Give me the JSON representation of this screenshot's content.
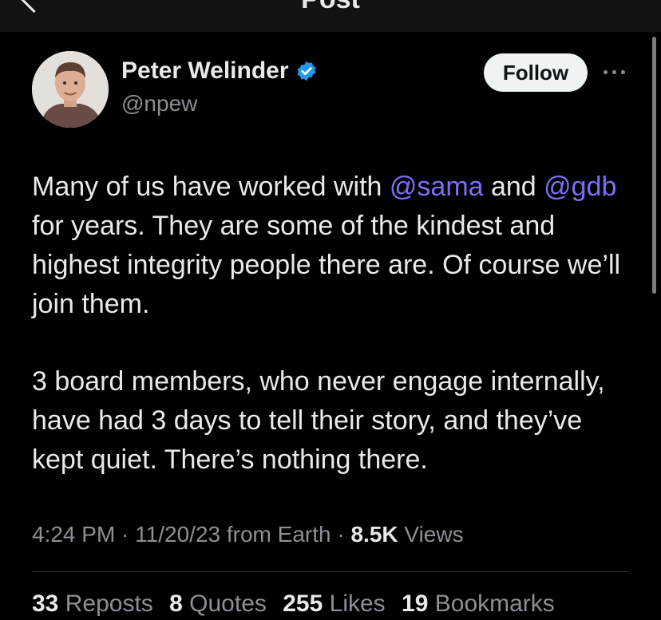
{
  "header": {
    "title": "Post"
  },
  "author": {
    "name": "Peter Welinder",
    "handle": "@npew",
    "verified": true,
    "verified_color": "#1d9bf0"
  },
  "follow_label": "Follow",
  "tweet": {
    "paragraph1": {
      "part1": "Many of us have worked with ",
      "mention1": "@sama",
      "part2": " and ",
      "mention2": "@gdb",
      "part3": " for years. They are some of the kindest and highest integrity people there are. Of course we’ll join them."
    },
    "paragraph2": "3 board members, who never engage internally, have had 3 days to tell their story, and they’ve kept quiet. There’s nothing there.",
    "mention_color": "#7c6ff6"
  },
  "meta": {
    "time": "4:24 PM",
    "sep1": " · ",
    "date": "11/20/23",
    "source": " from Earth",
    "sep2": " · ",
    "views_count": "8.5K",
    "views_label": " Views"
  },
  "stats": [
    {
      "count": "33",
      "label": "Reposts"
    },
    {
      "count": "8",
      "label": "Quotes"
    },
    {
      "count": "255",
      "label": "Likes"
    },
    {
      "count": "19",
      "label": "Bookmarks"
    }
  ],
  "icons": {
    "back": "back-arrow-icon",
    "verified": "verified-badge-icon",
    "more": "more-options-icon"
  }
}
